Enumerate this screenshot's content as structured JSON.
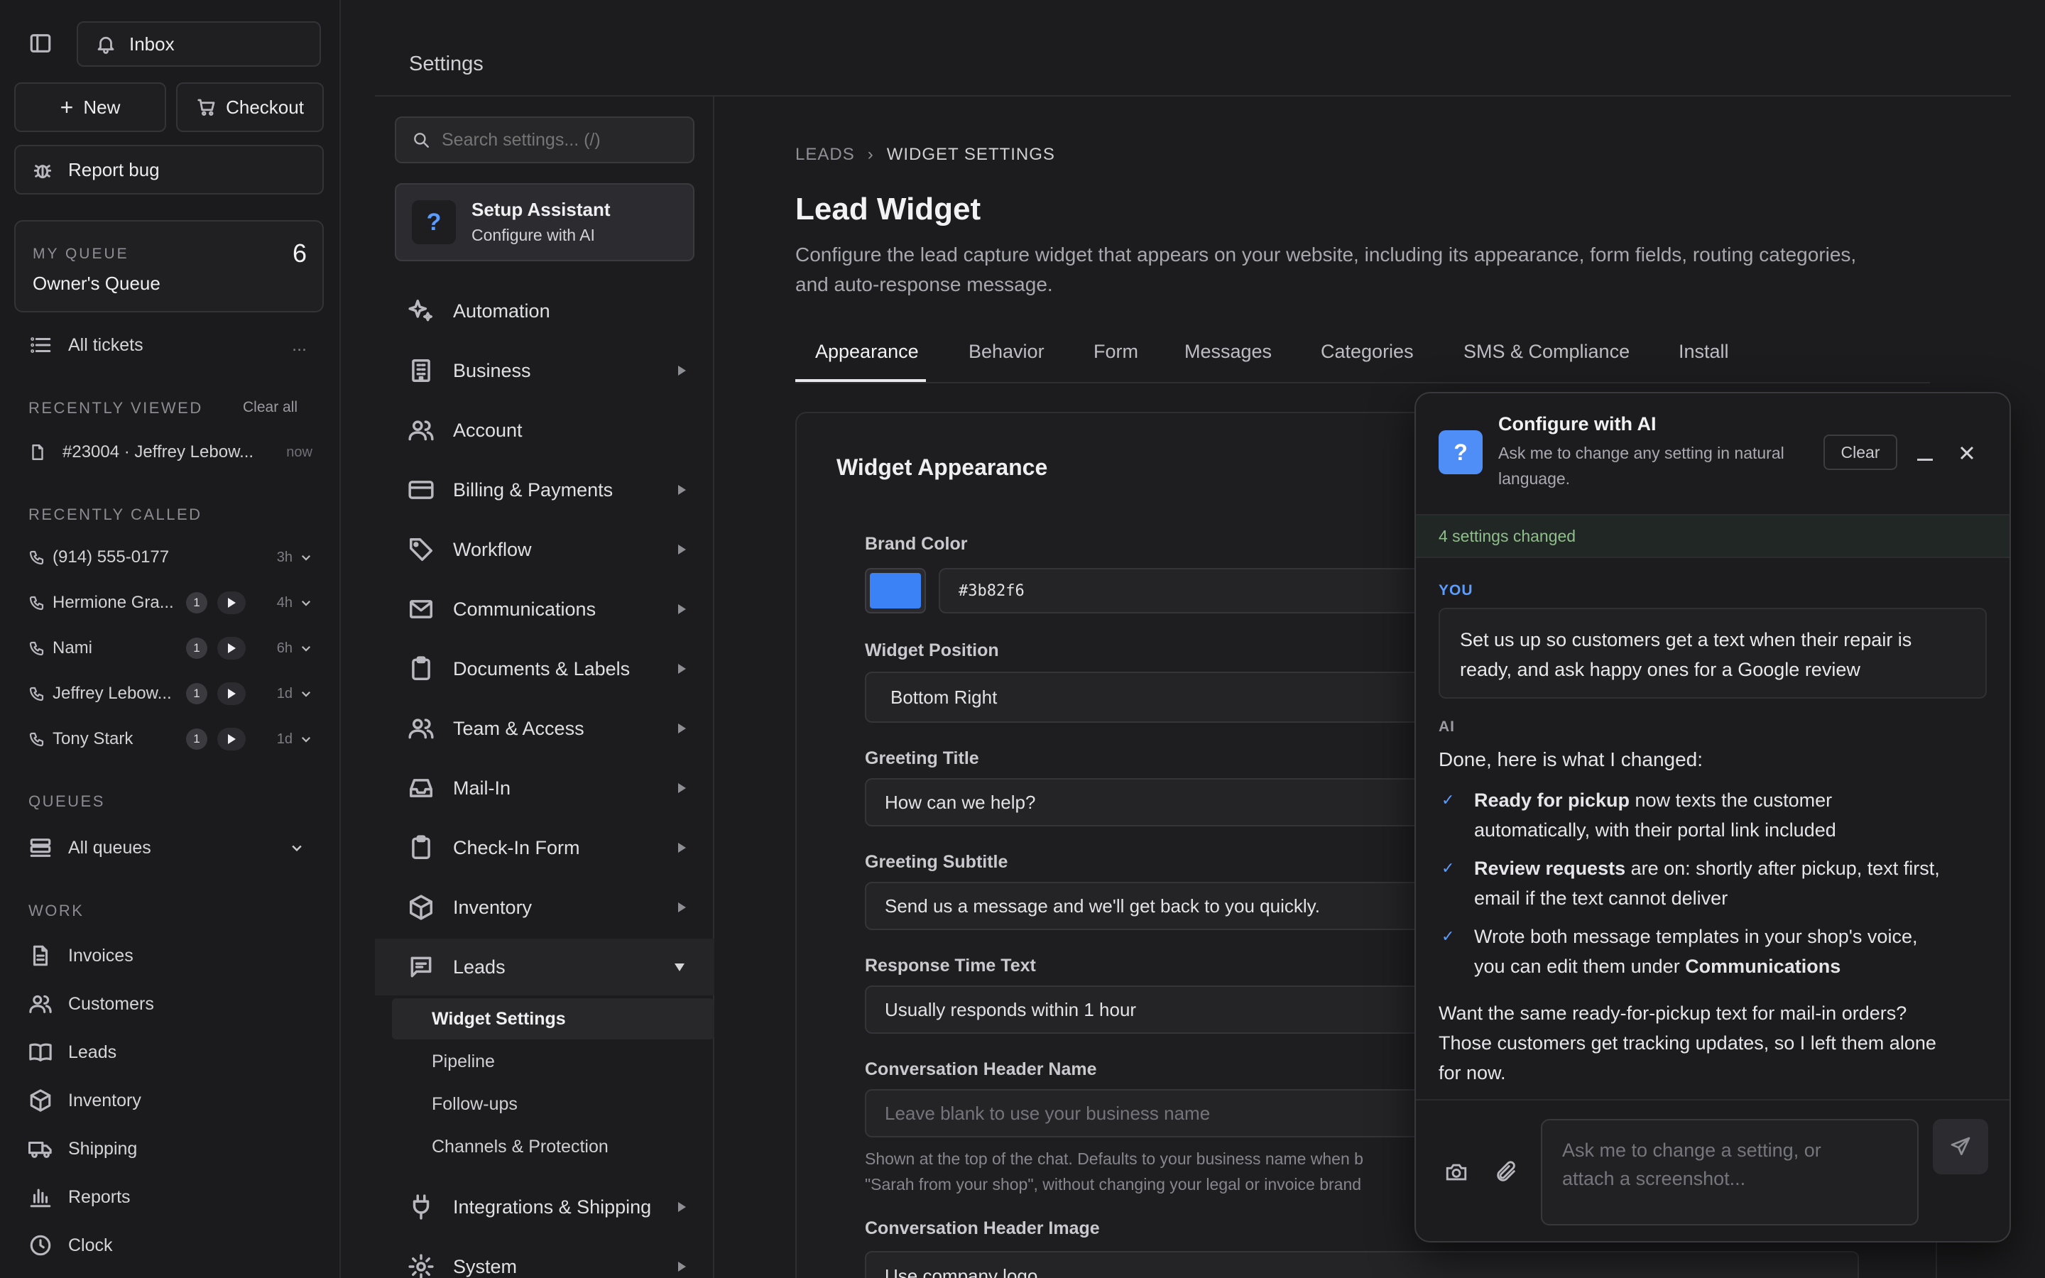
{
  "sidebar": {
    "inbox_label": "Inbox",
    "new_label": "New",
    "checkout_label": "Checkout",
    "report_bug_label": "Report bug",
    "queue": {
      "section_label": "MY QUEUE",
      "name": "Owner's Queue",
      "count": "6"
    },
    "all_tickets_label": "All tickets",
    "all_tickets_more": "...",
    "recently_viewed": {
      "title": "RECENTLY VIEWED",
      "clear_label": "Clear all",
      "items": [
        {
          "label": "#23004 · Jeffrey Lebow...",
          "time": "now"
        }
      ]
    },
    "recently_called": {
      "title": "RECENTLY CALLED",
      "items": [
        {
          "name": "(914) 555-0177",
          "count": "",
          "time": "3h"
        },
        {
          "name": "Hermione Gra...",
          "count": "1",
          "time": "4h"
        },
        {
          "name": "Nami",
          "count": "1",
          "time": "6h"
        },
        {
          "name": "Jeffrey Lebow...",
          "count": "1",
          "time": "1d"
        },
        {
          "name": "Tony Stark",
          "count": "1",
          "time": "1d"
        }
      ]
    },
    "queues": {
      "title": "QUEUES",
      "all_label": "All queues"
    },
    "work": {
      "title": "WORK",
      "items": [
        {
          "label": "Invoices",
          "icon": "invoice-icon"
        },
        {
          "label": "Customers",
          "icon": "users-icon"
        },
        {
          "label": "Leads",
          "icon": "book-icon"
        },
        {
          "label": "Inventory",
          "icon": "box-icon"
        },
        {
          "label": "Shipping",
          "icon": "truck-icon"
        },
        {
          "label": "Reports",
          "icon": "chart-icon"
        },
        {
          "label": "Clock",
          "icon": "clock-icon"
        }
      ]
    }
  },
  "header": {
    "title": "Settings"
  },
  "settings_nav": {
    "search_placeholder": "Search settings... (/)",
    "assistant": {
      "title": "Setup Assistant",
      "subtitle": "Configure with AI"
    },
    "items": [
      {
        "label": "Automation",
        "icon": "sparkle-icon"
      },
      {
        "label": "Business",
        "icon": "building-icon"
      },
      {
        "label": "Account",
        "icon": "users-icon"
      },
      {
        "label": "Billing & Payments",
        "icon": "card-icon"
      },
      {
        "label": "Workflow",
        "icon": "tag-icon"
      },
      {
        "label": "Communications",
        "icon": "mail-icon"
      },
      {
        "label": "Documents & Labels",
        "icon": "clipboard-icon"
      },
      {
        "label": "Team & Access",
        "icon": "team-icon"
      },
      {
        "label": "Mail-In",
        "icon": "inbox-icon"
      },
      {
        "label": "Check-In Form",
        "icon": "clipboard-icon"
      },
      {
        "label": "Inventory",
        "icon": "box-icon"
      },
      {
        "label": "Leads",
        "icon": "message-icon"
      }
    ],
    "leads_subitems": [
      "Widget Settings",
      "Pipeline",
      "Follow-ups",
      "Channels & Protection"
    ],
    "after_items": [
      {
        "label": "Integrations & Shipping",
        "icon": "plug-icon"
      },
      {
        "label": "System",
        "icon": "gear-icon"
      }
    ]
  },
  "content": {
    "breadcrumb": {
      "parent": "LEADS",
      "separator": "›",
      "current": "WIDGET SETTINGS"
    },
    "title": "Lead Widget",
    "description_line1": "Configure the lead capture widget that appears on your website, including its appearance, form fields, routing categories,",
    "description_line2": "and auto-response message.",
    "tabs": [
      "Appearance",
      "Behavior",
      "Form",
      "Messages",
      "Categories",
      "SMS & Compliance",
      "Install"
    ],
    "card_title": "Widget Appearance",
    "fields": {
      "brand_color": {
        "label": "Brand Color",
        "value": "#3b82f6"
      },
      "widget_position": {
        "label": "Widget Position",
        "value": "Bottom Right"
      },
      "greeting_title": {
        "label": "Greeting Title",
        "value": "How can we help?"
      },
      "greeting_subtitle": {
        "label": "Greeting Subtitle",
        "value": "Send us a message and we'll get back to you quickly."
      },
      "response_time": {
        "label": "Response Time Text",
        "value": "Usually responds within 1 hour"
      },
      "conversation_header_name": {
        "label": "Conversation Header Name",
        "placeholder": "Leave blank to use your business name",
        "help_line1": "Shown at the top of the chat. Defaults to your business name when b",
        "help_line2": "\"Sarah from your shop\", without changing your legal or invoice brand"
      },
      "conversation_header_image": {
        "label": "Conversation Header Image",
        "value": "Use company logo"
      }
    }
  },
  "ai_panel": {
    "title": "Configure with AI",
    "subtitle_line1": "Ask me to change any setting in natural",
    "subtitle_line2": "language.",
    "clear_label": "Clear",
    "changed_notice": "4 settings changed",
    "you_label": "YOU",
    "user_message_line1": "Set us up so customers get a text when their repair is",
    "user_message_line2": "ready, and ask happy ones for a Google review",
    "ai_label": "AI",
    "ai_intro": "Done, here is what I changed:",
    "changes": [
      {
        "bold": "Ready for pickup",
        "rest1": " now texts the customer",
        "rest2": "automatically, with their portal link included"
      },
      {
        "bold": "Review requests",
        "rest1": " are on: shortly after pickup, text first,",
        "rest2": "email if the text cannot deliver"
      },
      {
        "lead": "Wrote both message templates in your shop's voice,",
        "rest2": "you can edit them under ",
        "bold2": "Communications"
      }
    ],
    "followup_line1": "Want the same ready-for-pickup text for mail-in orders?",
    "followup_line2": "Those customers get tracking updates, so I left them alone",
    "followup_line3": "for now.",
    "input_placeholder_line1": "Ask me to change a setting, or",
    "input_placeholder_line2": "attach a screenshot..."
  },
  "colors": {
    "accent": "#3b82f6",
    "success_text": "#8fbf8a",
    "background": "#1c1c1e"
  }
}
